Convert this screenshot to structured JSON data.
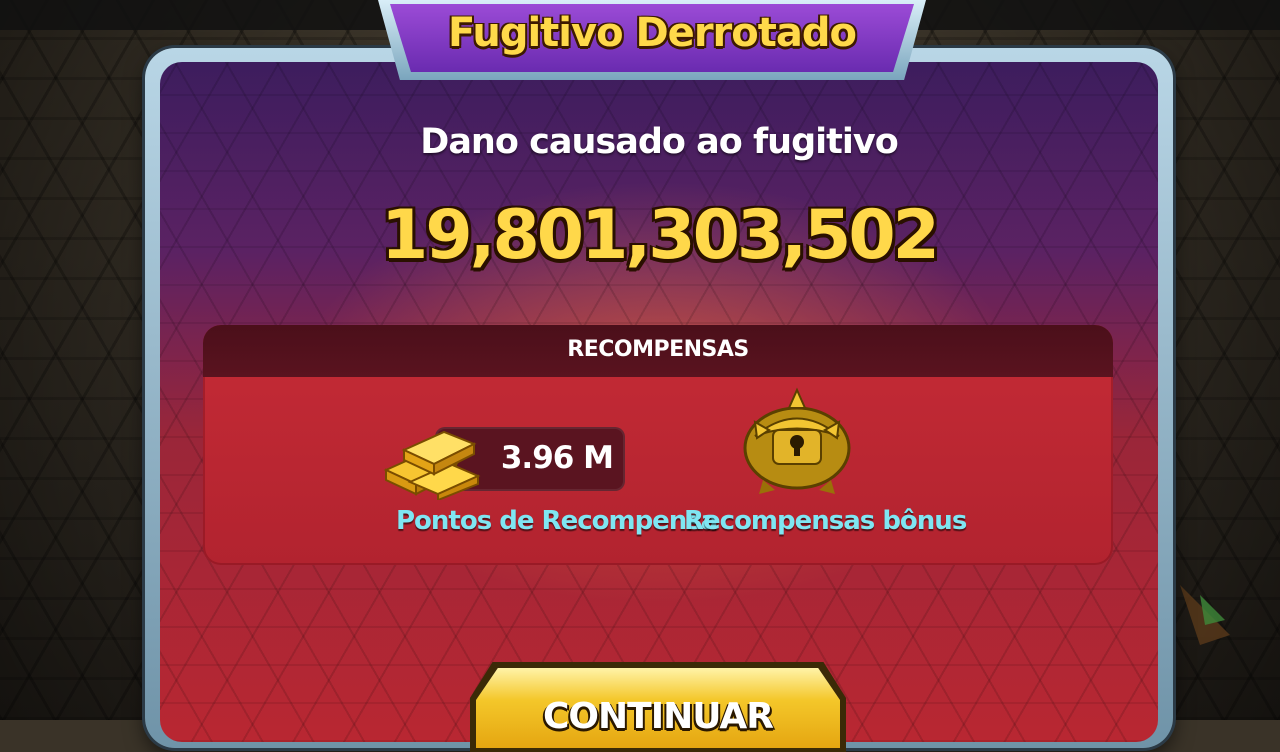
{
  "screen": {
    "title": "Fugitivo Derrotado",
    "damage_label": "Dano causado ao fugitivo",
    "damage_value": "19,801,303,502"
  },
  "rewards": {
    "header": "RECOMPENSAS",
    "points": {
      "value": "3.96 M",
      "label": "Pontos de Recompensa",
      "icon": "gold-bars-icon"
    },
    "bonus": {
      "label": "Recompensas bônus",
      "icon": "treasure-chest-icon"
    }
  },
  "continue_button": {
    "label": "CONTINUAR"
  },
  "colors": {
    "title_gold": "#ffd94a",
    "label_cyan": "#7fe6f2",
    "banner_purple": "#7a34c0",
    "panel_red": "#b92732",
    "button_yellow": "#f4c72a"
  }
}
